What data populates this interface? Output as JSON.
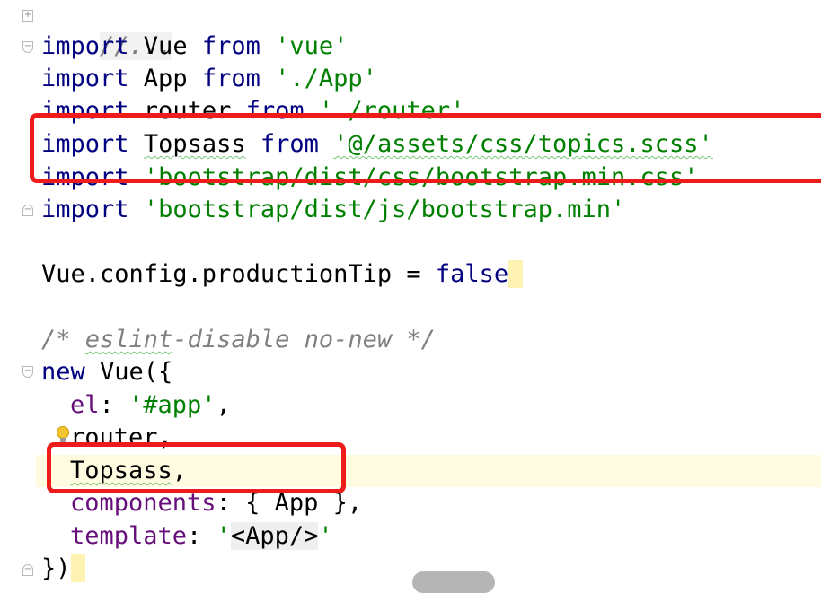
{
  "editor": {
    "collapsed_region": "//...",
    "lines": {
      "l1": {
        "kw": "import",
        "rest": " Vue ",
        "kw2": "from",
        "sp": " ",
        "str": "'vue'"
      },
      "l2": {
        "kw": "import",
        "rest": " App ",
        "kw2": "from",
        "sp": " ",
        "str": "'./App'"
      },
      "l3": {
        "kw": "import",
        "rest": " router ",
        "kw2": "from",
        "sp": " ",
        "str": "'./router'"
      },
      "l4": {
        "kw": "import",
        "sp1": " ",
        "ident": "Topsass",
        "sp2": " ",
        "kw2": "from",
        "sp": " ",
        "str": "'@/assets/css/topics.scss'"
      },
      "l5": {
        "kw": "import",
        "sp": " ",
        "str": "'bootstrap/dist/css/bootstrap.min.css'"
      },
      "l6": {
        "kw": "import",
        "sp": " ",
        "str": "'bootstrap/dist/js/bootstrap.min'"
      },
      "l7": {
        "code": "Vue.config.productionTip = ",
        "kw": "false"
      },
      "l8": {
        "c1": "/* ",
        "c2": "eslint",
        "c3": "-disable no-new */"
      },
      "l9": {
        "kw": "new",
        "code": " Vue({"
      },
      "l10": {
        "prop": "el",
        "punct": ": ",
        "str": "'#app'",
        "end": ","
      },
      "l11": {
        "code": "router,"
      },
      "l12": {
        "ident": "Topsass",
        "end": ","
      },
      "l13": {
        "prop": "components",
        "code": ": { App },"
      },
      "l14": {
        "prop": "template",
        "punct": ": ",
        "q1": "'",
        "tag": "<App/>",
        "q2": "'"
      },
      "l15": {
        "code": "})"
      }
    }
  },
  "colors": {
    "keyword": "#000080",
    "string": "#008000",
    "property": "#660e7a",
    "comment": "#808080",
    "annotation_box": "#ee1b1b",
    "caret_line": "#fffbe0"
  },
  "icons": {
    "fold_expand": "plus",
    "fold_collapse": "minus",
    "intention": "lightbulb-icon"
  }
}
